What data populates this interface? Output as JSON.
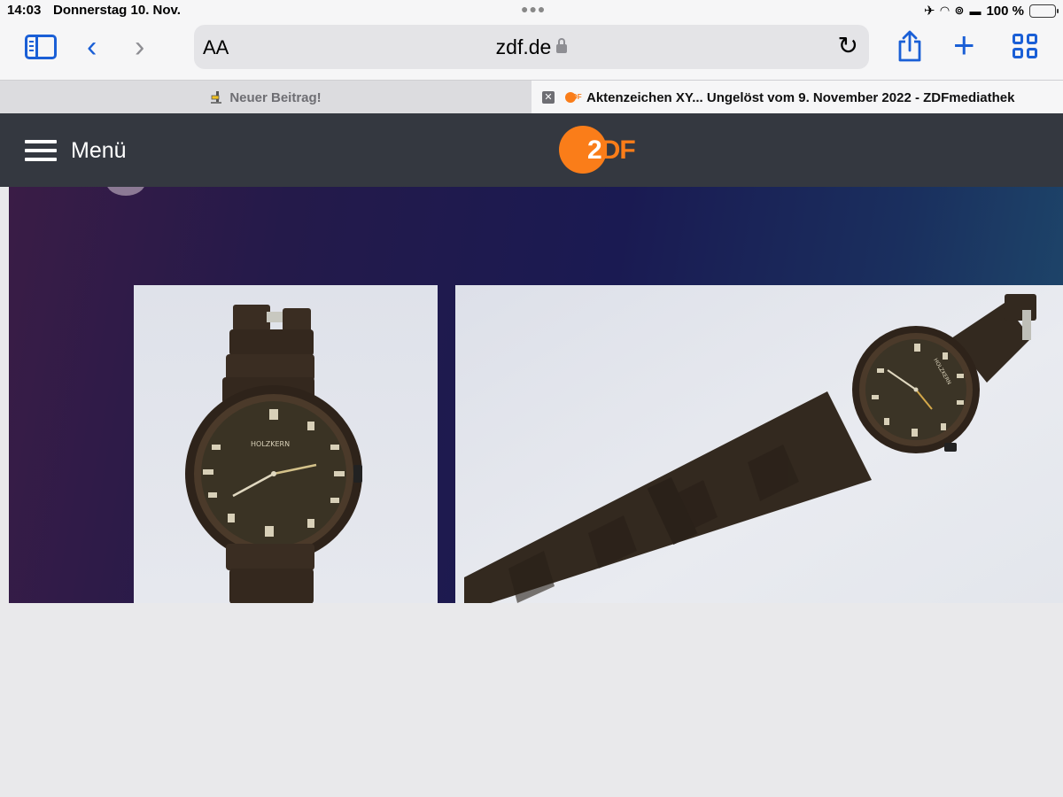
{
  "status_bar": {
    "time": "14:03",
    "date": "Donnerstag 10. Nov.",
    "battery": "100 %"
  },
  "toolbar": {
    "text_size_label": "AA",
    "url": "zdf.de"
  },
  "tabs": [
    {
      "title": "Neuer Beitrag!",
      "active": false
    },
    {
      "title": "Aktenzeichen XY... Ungelöst vom 9. November 2022 - ZDFmediathek",
      "active": true
    }
  ],
  "site_header": {
    "menu_label": "Menü",
    "logo_text": "ZDF"
  },
  "content": {
    "images": [
      {
        "name": "watch-front-photo",
        "brand_on_dial": "HOLZKERN"
      },
      {
        "name": "watch-band-photo",
        "brand_on_dial": "HOLZKERN"
      }
    ]
  },
  "colors": {
    "accent_blue": "#1a5fd6",
    "zdf_orange": "#fa7d19",
    "header_bg": "#343840"
  }
}
